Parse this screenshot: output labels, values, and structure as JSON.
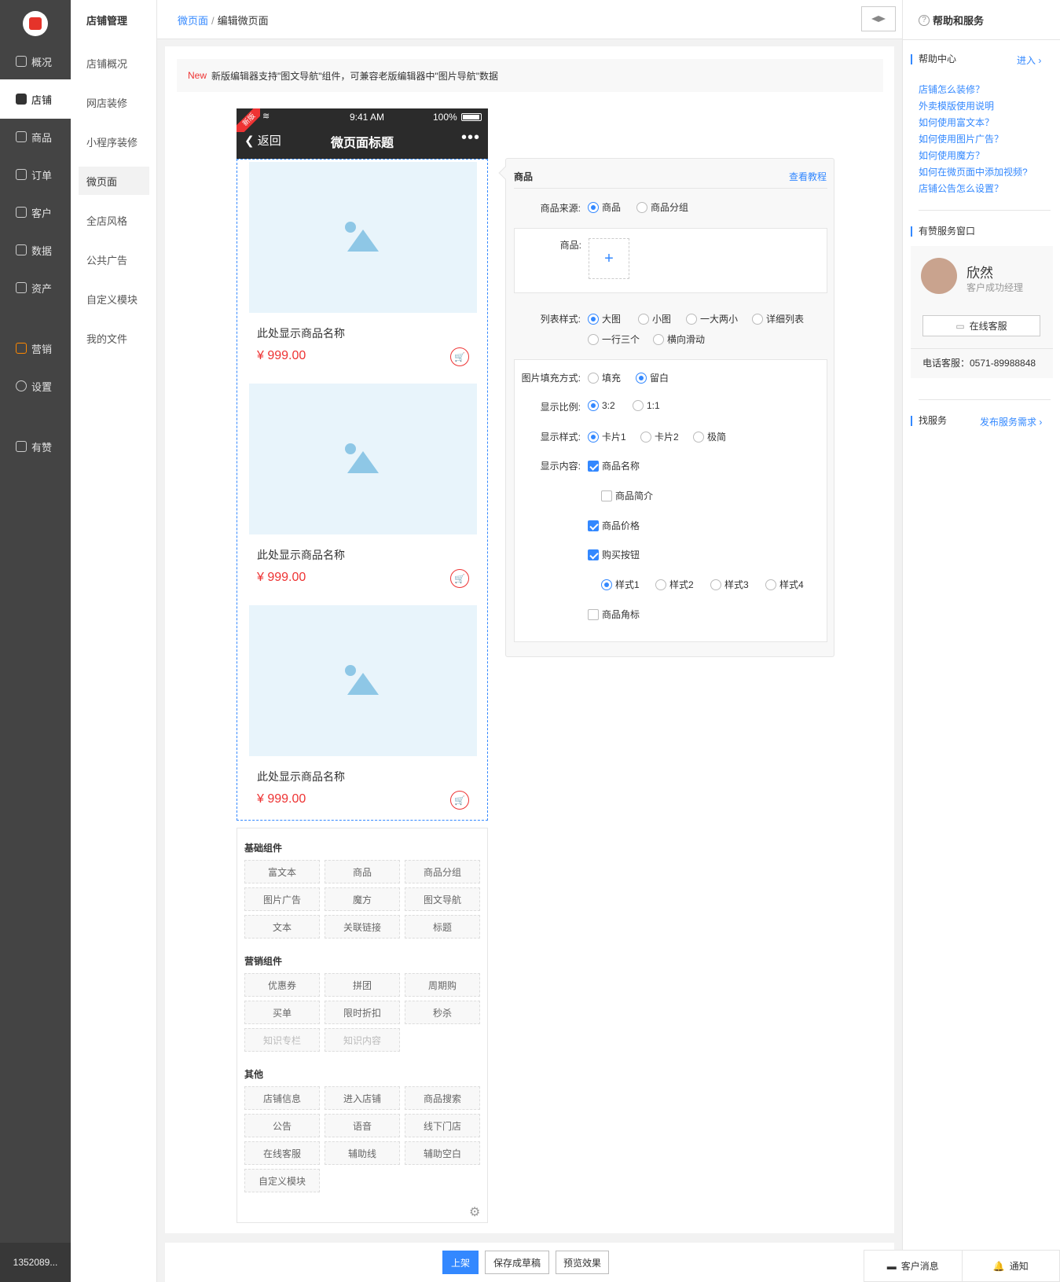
{
  "sidebar": {
    "phone": "1352089...",
    "items": [
      {
        "label": "概况",
        "icon": "overview-icon"
      },
      {
        "label": "店铺",
        "icon": "store-icon"
      },
      {
        "label": "商品",
        "icon": "tag-icon"
      },
      {
        "label": "订单",
        "icon": "order-icon"
      },
      {
        "label": "客户",
        "icon": "user-icon"
      },
      {
        "label": "数据",
        "icon": "chart-icon"
      },
      {
        "label": "资产",
        "icon": "yen-icon"
      },
      {
        "label": "营销",
        "icon": "apps-icon"
      },
      {
        "label": "设置",
        "icon": "gear-icon"
      },
      {
        "label": "有赞",
        "icon": "thumbs-up-icon"
      }
    ]
  },
  "subnav": {
    "title": "店铺管理",
    "items": [
      "店铺概况",
      "网店装修",
      "小程序装修",
      "微页面",
      "全店风格",
      "公共广告",
      "自定义模块",
      "我的文件"
    ]
  },
  "header": {
    "crumb_link": "微页面",
    "crumb_sep": "/",
    "crumb_current": "编辑微页面"
  },
  "notice": {
    "badge": "New",
    "text": "新版编辑器支持\"图文导航\"组件，可兼容老版编辑器中\"图片导航\"数据"
  },
  "phone": {
    "badge": "新版",
    "time": "9:41 AM",
    "battery": "100%",
    "back": "返回",
    "title": "微页面标题",
    "products": [
      {
        "name": "此处显示商品名称",
        "price": "¥ 999.00"
      },
      {
        "name": "此处显示商品名称",
        "price": "¥ 999.00"
      },
      {
        "name": "此处显示商品名称",
        "price": "¥ 999.00"
      }
    ]
  },
  "components": {
    "groups": [
      {
        "title": "基础组件",
        "items": [
          "富文本",
          "商品",
          "商品分组",
          "图片广告",
          "魔方",
          "图文导航",
          "文本",
          "关联链接",
          "标题"
        ]
      },
      {
        "title": "营销组件",
        "items": [
          "优惠券",
          "拼团",
          "周期购",
          "买单",
          "限时折扣",
          "秒杀",
          "知识专栏",
          "知识内容"
        ]
      },
      {
        "title": "其他",
        "items": [
          "店铺信息",
          "进入店铺",
          "商品搜索",
          "公告",
          "语音",
          "线下门店",
          "在线客服",
          "辅助线",
          "辅助空白",
          "自定义模块"
        ]
      }
    ]
  },
  "editor": {
    "title": "商品",
    "tutorial": "查看教程",
    "source_label": "商品来源:",
    "source_opts": [
      "商品",
      "商品分组"
    ],
    "goods_label": "商品:",
    "list_label": "列表样式:",
    "list_opts": [
      "大图",
      "小图",
      "一大两小",
      "详细列表",
      "一行三个",
      "横向滑动"
    ],
    "fill_label": "图片填充方式:",
    "fill_opts": [
      "填充",
      "留白"
    ],
    "ratio_label": "显示比例:",
    "ratio_opts": [
      "3:2",
      "1:1"
    ],
    "style_label": "显示样式:",
    "style_opts": [
      "卡片1",
      "卡片2",
      "极简"
    ],
    "content_label": "显示内容:",
    "content_opts": [
      "商品名称",
      "商品简介",
      "商品价格",
      "购买按钮",
      "商品角标"
    ],
    "btn_styles": [
      "样式1",
      "样式2",
      "样式3",
      "样式4"
    ]
  },
  "help": {
    "title": "帮助和服务",
    "center": "帮助中心",
    "enter": "进入",
    "links": [
      "店铺怎么装修？",
      "外卖模版使用说明",
      "如何使用富文本？",
      "如何使用图片广告？",
      "如何使用魔方？",
      "如何在微页面中添加视频?",
      "店铺公告怎么设置？"
    ],
    "window": "有赞服务窗口",
    "agent_name": "欣然",
    "agent_role": "客户成功经理",
    "online": "在线客服",
    "phone": "电话客服：0571-89988848",
    "find": "找服务",
    "publish": "发布服务需求"
  },
  "bottom": {
    "publish": "上架",
    "draft": "保存成草稿",
    "preview": "预览效果",
    "messages": "客户消息",
    "notify": "通知"
  },
  "colors": {
    "accent": "#3388ff",
    "price": "#ee3333",
    "sidebar": "#444444"
  }
}
